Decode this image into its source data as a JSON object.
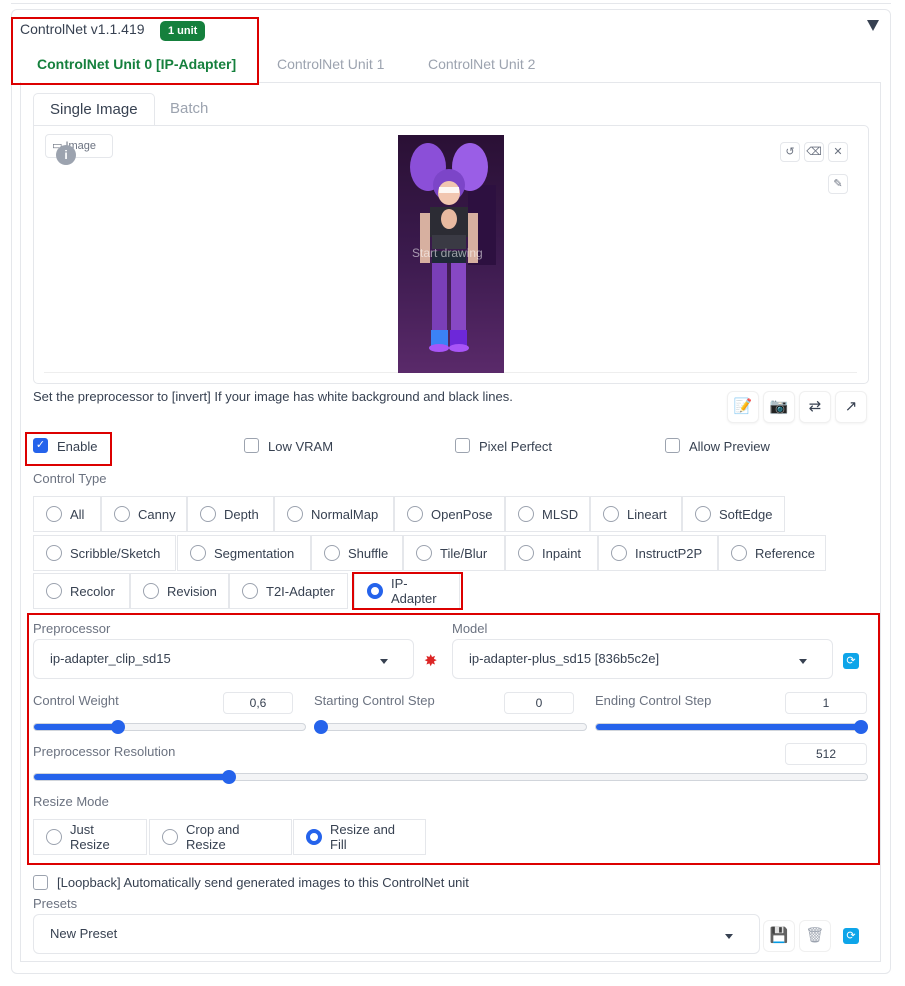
{
  "header": {
    "title": "ControlNet v1.1.419",
    "badge": "1 unit"
  },
  "unit_tabs": [
    "ControlNet Unit 0 [IP-Adapter]",
    "ControlNet Unit 1",
    "ControlNet Unit 2"
  ],
  "image_tabs": [
    "Single Image",
    "Batch"
  ],
  "image": {
    "label": "Image",
    "overlay_text": "Start drawing"
  },
  "hint": "Set the preprocessor to [invert] If your image has white background and black lines.",
  "options": {
    "enable": "Enable",
    "low_vram": "Low VRAM",
    "pixel_perfect": "Pixel Perfect",
    "allow_preview": "Allow Preview"
  },
  "control_type": {
    "label": "Control Type",
    "row1": [
      "All",
      "Canny",
      "Depth",
      "NormalMap",
      "OpenPose",
      "MLSD",
      "Lineart",
      "SoftEdge"
    ],
    "row2": [
      "Scribble/Sketch",
      "Segmentation",
      "Shuffle",
      "Tile/Blur",
      "Inpaint",
      "InstructP2P",
      "Reference"
    ],
    "row3": [
      "Recolor",
      "Revision",
      "T2I-Adapter",
      "IP-Adapter"
    ],
    "selected": "IP-Adapter"
  },
  "preprocessor": {
    "label": "Preprocessor",
    "value": "ip-adapter_clip_sd15"
  },
  "model": {
    "label": "Model",
    "value": "ip-adapter-plus_sd15 [836b5c2e]"
  },
  "sliders": {
    "control_weight": {
      "label": "Control Weight",
      "value": "0,6",
      "level": 0.3
    },
    "starting_step": {
      "label": "Starting Control Step",
      "value": "0",
      "level": 0.0
    },
    "ending_step": {
      "label": "Ending Control Step",
      "value": "1",
      "level": 1.0
    },
    "preprocessor_resolution": {
      "label": "Preprocessor Resolution",
      "value": "512",
      "level": 0.23
    }
  },
  "resize_mode": {
    "label": "Resize Mode",
    "options": [
      "Just Resize",
      "Crop and Resize",
      "Resize and Fill"
    ],
    "selected": "Resize and Fill"
  },
  "loopback": "[Loopback] Automatically send generated images to this ControlNet unit",
  "presets": {
    "label": "Presets",
    "value": "New Preset"
  },
  "colors": {
    "accent": "#2563eb",
    "active_tab": "#15803d",
    "highlight": "#dc0000"
  },
  "icons": [
    "pencil-icon",
    "camera-icon",
    "swap-icon",
    "send-icon",
    "refresh-icon",
    "save-icon",
    "trash-icon",
    "explode-icon"
  ]
}
